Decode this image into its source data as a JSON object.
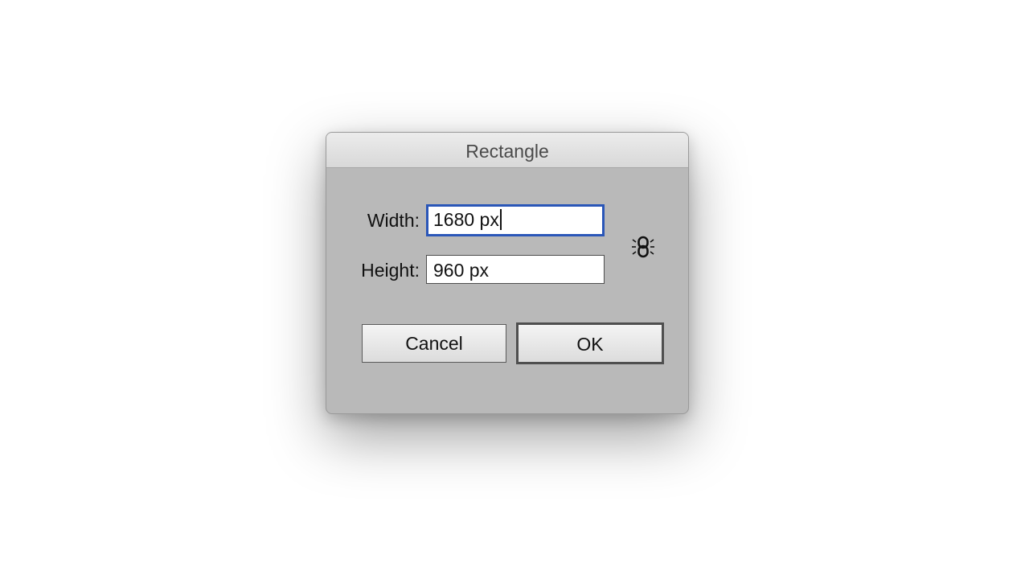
{
  "dialog": {
    "title": "Rectangle",
    "width_label": "Width:",
    "width_value": "1680 px",
    "height_label": "Height:",
    "height_value": "960 px",
    "constrain_icon": "link-proportions-icon",
    "cancel_label": "Cancel",
    "ok_label": "OK"
  },
  "colors": {
    "dialog_bg": "#b9b9b9",
    "focus_ring": "#2a56b8"
  }
}
